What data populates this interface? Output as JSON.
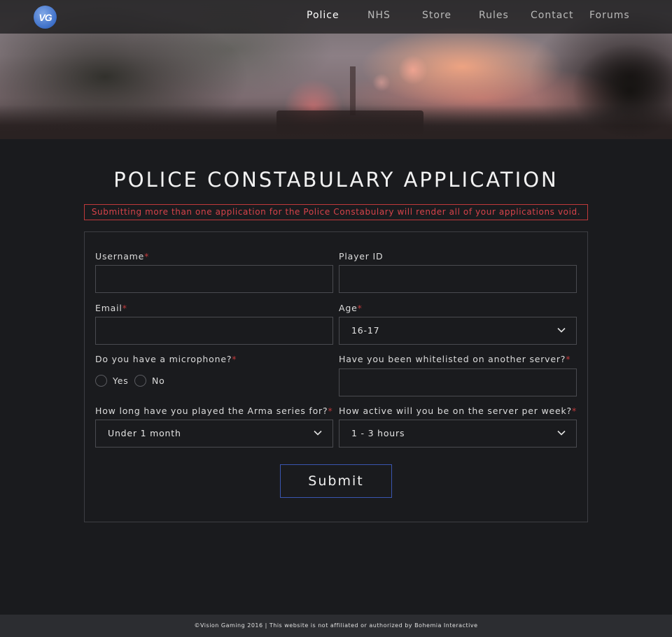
{
  "brand": {
    "logo_text": "VG"
  },
  "nav": {
    "items": [
      {
        "label": "Police",
        "active": true
      },
      {
        "label": "NHS",
        "active": false
      },
      {
        "label": "Store",
        "active": false
      },
      {
        "label": "Rules",
        "active": false
      },
      {
        "label": "Contact",
        "active": false
      },
      {
        "label": "Forums",
        "active": false
      }
    ]
  },
  "page": {
    "title": "POLICE CONSTABULARY APPLICATION",
    "warning": "Submitting more than one application for the Police Constabulary will render all of your applications void."
  },
  "form": {
    "required_marker": "*",
    "username": {
      "label": "Username",
      "value": "",
      "placeholder": ""
    },
    "player_id": {
      "label": "Player ID",
      "value": "",
      "placeholder": ""
    },
    "email": {
      "label": "Email",
      "value": "",
      "placeholder": ""
    },
    "age": {
      "label": "Age",
      "selected": "16-17"
    },
    "microphone": {
      "label": "Do you have a microphone?",
      "options": [
        "Yes",
        "No"
      ],
      "selected": null
    },
    "whitelisted": {
      "label": "Have you been whitelisted on another server?",
      "value": "",
      "placeholder": ""
    },
    "arma_duration": {
      "label": "How long have you played the Arma series for?",
      "selected": "Under 1 month"
    },
    "activity": {
      "label": "How active will you be on the server per week?",
      "selected": "1 - 3 hours"
    },
    "submit_label": "Submit"
  },
  "footer": {
    "text": "©Vision Gaming 2016 | This website is not affiliated or authorized by Bohemia Interactive"
  },
  "colors": {
    "background": "#1a1b1e",
    "required": "#c0393b",
    "warning_text": "#d6434a",
    "submit_border": "#3a56b0",
    "footer_bg": "#2c2d31",
    "logo_blue": "#3d6fc8"
  },
  "icons": {
    "select_arrow": "chevron-down-icon"
  }
}
